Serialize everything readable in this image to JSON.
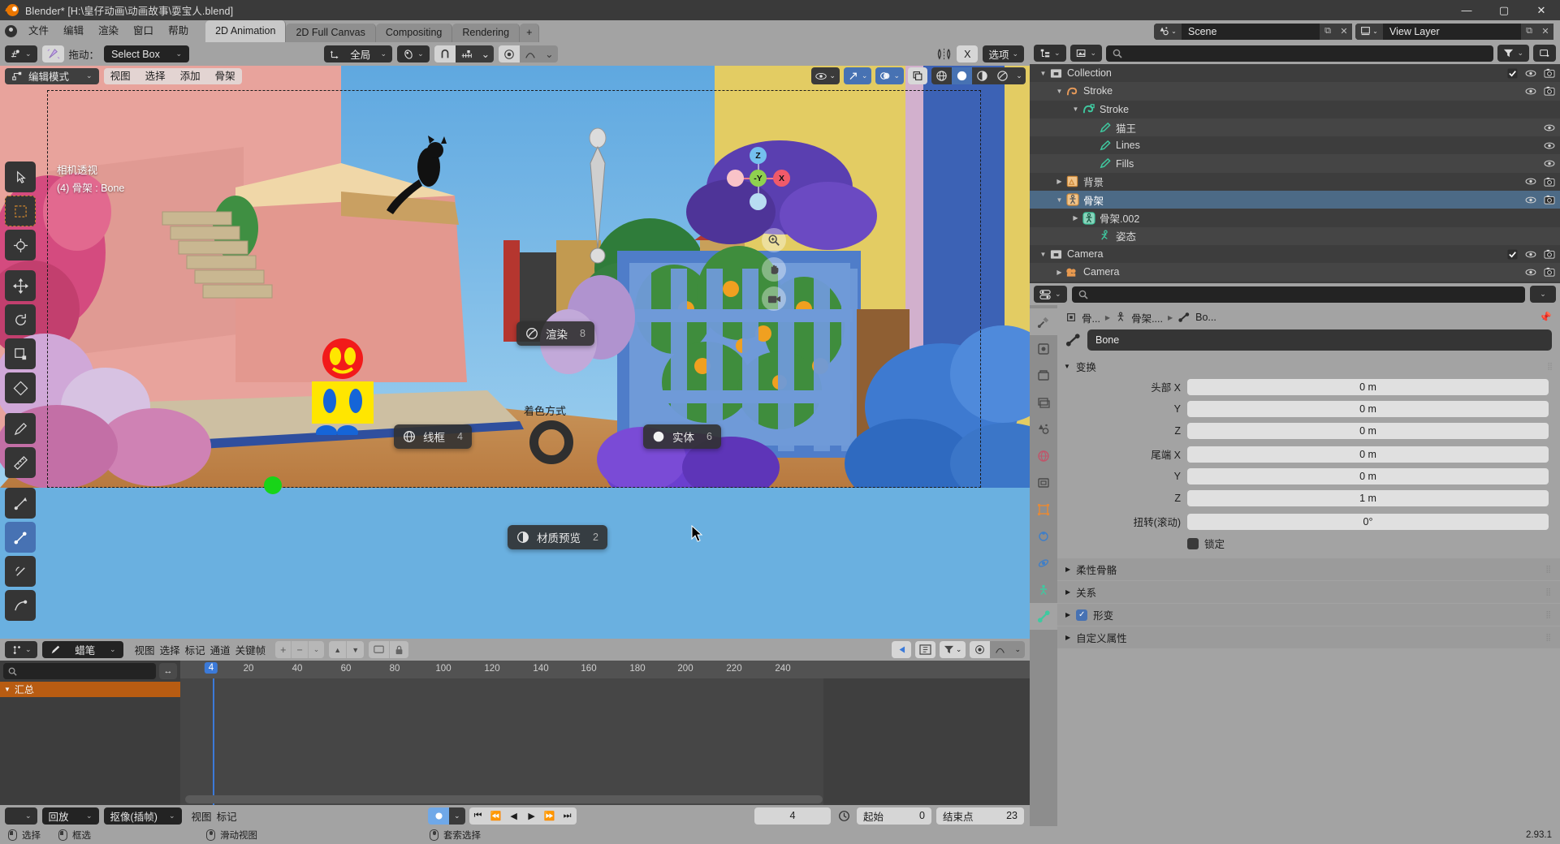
{
  "window": {
    "title": "Blender* [H:\\皇仔动画\\动画故事\\耍宝人.blend]",
    "minimize": "—",
    "maximize": "▢",
    "close": "✕"
  },
  "topbar": {
    "menus": [
      "文件",
      "编辑",
      "渲染",
      "窗口",
      "帮助"
    ],
    "workspaces": [
      {
        "label": "2D Animation",
        "active": true
      },
      {
        "label": "2D Full Canvas",
        "active": false
      },
      {
        "label": "Compositing",
        "active": false
      },
      {
        "label": "Rendering",
        "active": false
      },
      {
        "label": "+",
        "active": false
      }
    ],
    "scene_name": "Scene",
    "view_layer_name": "View Layer"
  },
  "tool_header": {
    "drag_label": "拖动：",
    "drag_value": "Select Box",
    "orientation": "全局",
    "snap_icons": [
      "snap-magnet-icon",
      "snap-increment-icon"
    ],
    "proportional_icons": [
      "proportional-edit-icon",
      "falloff-curve-icon"
    ],
    "mirror_icon": "mirror-x-icon",
    "mirror_axis": "X",
    "options_label": "选项"
  },
  "viewport": {
    "mode": "编辑模式",
    "menus": [
      "视图",
      "选择",
      "添加",
      "骨架"
    ],
    "overlay_text_line1": "相机透视",
    "overlay_text_line2": "(4) 骨架 : Bone",
    "gizmo": {
      "z": "Z",
      "y": "-Y",
      "x": "X"
    },
    "shading_modes": [
      "wireframe-icon",
      "solid-icon",
      "material-preview-icon",
      "rendered-icon"
    ],
    "selected_shading_index": 1,
    "pie_menu": {
      "title": "着色方式",
      "items": [
        {
          "label": "渲染",
          "number": "8",
          "icon": "rendered-sphere-icon",
          "position": "top-right"
        },
        {
          "label": "线框",
          "number": "4",
          "icon": "wireframe-globe-icon",
          "position": "left"
        },
        {
          "label": "实体",
          "number": "6",
          "icon": "solid-sphere-icon",
          "position": "right"
        },
        {
          "label": "材质预览",
          "number": "2",
          "icon": "material-sphere-icon",
          "position": "bottom"
        }
      ]
    }
  },
  "dopesheet": {
    "editor_type": "蜡笔",
    "menus": [
      "视图",
      "选择",
      "标记",
      "通道",
      "关键帧"
    ],
    "search_placeholder": "",
    "channel_group": "汇总",
    "ruler_ticks": [
      "20",
      "40",
      "60",
      "80",
      "100",
      "120",
      "140",
      "160",
      "180",
      "200",
      "220",
      "240"
    ],
    "current_frame_marker": "4"
  },
  "timeline": {
    "menus": [
      "视图",
      "标记"
    ],
    "playback_label": "回放",
    "keying_label": "抠像(插帧)",
    "transport": [
      "jump-start-icon",
      "prev-keyframe-icon",
      "play-reverse-icon",
      "play-icon",
      "next-keyframe-icon",
      "jump-end-icon"
    ],
    "current_frame": "4",
    "start_label": "起始",
    "start_value": "0",
    "end_label": "结束点",
    "end_value": "23"
  },
  "outliner": {
    "search_placeholder": "",
    "rows": [
      {
        "label": "Collection",
        "icon": "collection-icon",
        "depth": 0,
        "tri": "▼",
        "selected": false,
        "eye": true,
        "camera": true,
        "check": true
      },
      {
        "label": "Stroke",
        "icon": "grease-pencil-data-icon",
        "depth": 1,
        "tri": "▼",
        "selected": false,
        "eye": true,
        "camera": true,
        "check": false
      },
      {
        "label": "Stroke",
        "icon": "grease-pencil-object-icon",
        "depth": 2,
        "tri": "▼",
        "selected": false,
        "eye": false,
        "camera": false,
        "check": false
      },
      {
        "label": "猫王",
        "icon": "gp-layer-icon",
        "depth": 3,
        "tri": "",
        "selected": false,
        "eye": true,
        "camera": false,
        "check": false
      },
      {
        "label": "Lines",
        "icon": "gp-layer-icon",
        "depth": 3,
        "tri": "",
        "selected": false,
        "eye": true,
        "camera": false,
        "check": false
      },
      {
        "label": "Fills",
        "icon": "gp-layer-icon",
        "depth": 3,
        "tri": "",
        "selected": false,
        "eye": true,
        "camera": false,
        "check": false
      },
      {
        "label": "背景",
        "icon": "image-object-icon",
        "depth": 1,
        "tri": "▶",
        "selected": false,
        "eye": true,
        "camera": true,
        "check": false
      },
      {
        "label": "骨架",
        "icon": "armature-object-icon",
        "depth": 1,
        "tri": "▼",
        "selected": true,
        "eye": true,
        "camera": true,
        "check": false
      },
      {
        "label": "骨架.002",
        "icon": "armature-data-icon",
        "depth": 2,
        "tri": "▶",
        "selected": false,
        "eye": false,
        "camera": false,
        "check": false
      },
      {
        "label": "姿态",
        "icon": "pose-icon",
        "depth": 3,
        "tri": "",
        "selected": false,
        "eye": false,
        "camera": false,
        "check": false
      },
      {
        "label": "Camera",
        "icon": "collection-icon",
        "depth": 0,
        "tri": "▼",
        "selected": false,
        "eye": true,
        "camera": true,
        "check": true
      },
      {
        "label": "Camera",
        "icon": "camera-object-icon",
        "depth": 1,
        "tri": "▶",
        "selected": false,
        "eye": true,
        "camera": true,
        "check": false
      }
    ]
  },
  "properties": {
    "search_placeholder": "",
    "breadcrumb": [
      "骨...",
      "骨架....",
      "Bo..."
    ],
    "bone_name": "Bone",
    "transform_panel": "变换",
    "fields": [
      {
        "label": "头部 X",
        "value": "0 m"
      },
      {
        "label": "Y",
        "value": "0 m"
      },
      {
        "label": "Z",
        "value": "0 m"
      },
      {
        "label": "尾端 X",
        "value": "0 m"
      },
      {
        "label": "Y",
        "value": "0 m"
      },
      {
        "label": "Z",
        "value": "1 m"
      },
      {
        "label": "扭转(滚动)",
        "value": "0°"
      }
    ],
    "lock_label": "锁定",
    "sections": [
      {
        "label": "柔性骨骼",
        "checkbox": false
      },
      {
        "label": "关系",
        "checkbox": false
      },
      {
        "label": "形变",
        "checkbox": true
      },
      {
        "label": "自定义属性",
        "checkbox": false
      }
    ]
  },
  "statusbar": {
    "items": [
      {
        "mouse": "left",
        "label": "选择"
      },
      {
        "mouse": "left-drag",
        "label": "框选"
      },
      {
        "mouse": "middle",
        "label": "滑动视图"
      },
      {
        "mouse": "middle-drag",
        "label": "套索选择"
      }
    ],
    "version": "2.93.1"
  },
  "colors": {
    "accent_blue": "#4772b3",
    "header_gray": "#a3a3a3",
    "panel_dark": "#3d3d3d",
    "orange": "#ea7600"
  }
}
